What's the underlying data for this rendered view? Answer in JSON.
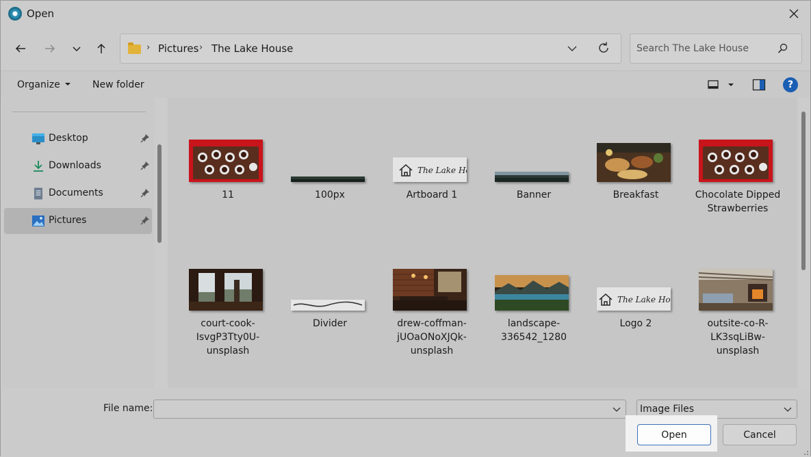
{
  "window": {
    "title": "Open",
    "app_icon": "app-icon",
    "close_icon": "close-icon"
  },
  "nav": {
    "back_icon": "arrow-left-icon",
    "forward_icon": "arrow-right-icon",
    "recent_icon": "chevron-down-icon",
    "up_icon": "arrow-up-icon",
    "breadcrumbs": [
      "Pictures",
      "The Lake House"
    ],
    "search_placeholder": "Search The Lake House"
  },
  "toolbar": {
    "organize_label": "Organize",
    "new_folder_label": "New folder"
  },
  "sidebar": {
    "items": [
      {
        "label": "Desktop",
        "icon": "desktop-icon",
        "pinned": true,
        "selected": false
      },
      {
        "label": "Downloads",
        "icon": "download-icon",
        "pinned": true,
        "selected": false
      },
      {
        "label": "Documents",
        "icon": "documents-icon",
        "pinned": true,
        "selected": false
      },
      {
        "label": "Pictures",
        "icon": "pictures-icon",
        "pinned": true,
        "selected": true
      }
    ]
  },
  "files": [
    {
      "name": "11"
    },
    {
      "name": "100px"
    },
    {
      "name": "Artboard 1",
      "logo_text": "The Lake House."
    },
    {
      "name": "Banner"
    },
    {
      "name": "Breakfast"
    },
    {
      "name": "Chocolate Dipped Strawberries"
    },
    {
      "name": "court-cook-IsvgP3Tty0U-unsplash"
    },
    {
      "name": "Divider"
    },
    {
      "name": "drew-coffman-jUOaONoXJQk-unsplash"
    },
    {
      "name": "landscape-336542_1280"
    },
    {
      "name": "Logo 2",
      "logo_text": "The Lake House."
    },
    {
      "name": "outsite-co-R-LK3sqLiBw-unsplash"
    }
  ],
  "footer": {
    "file_name_label": "File name:",
    "file_name_value": "",
    "file_type": "Image Files",
    "open_label": "Open",
    "cancel_label": "Cancel"
  },
  "colors": {
    "accent": "#1b5fb4",
    "folder": "#e2b33a"
  }
}
